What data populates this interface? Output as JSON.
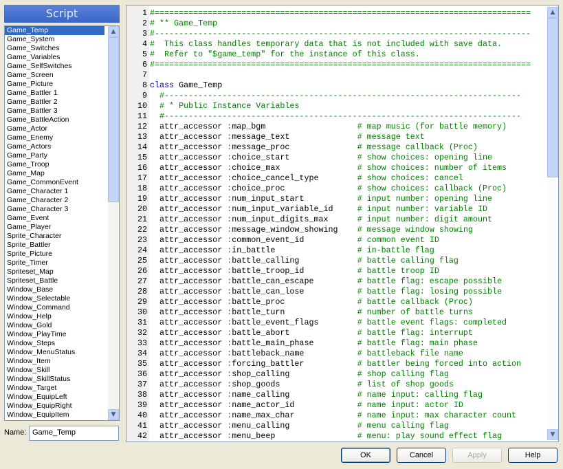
{
  "panel_title": "Script",
  "selected": "Game_Temp",
  "scripts": [
    "Game_Temp",
    "Game_System",
    "Game_Switches",
    "Game_Variables",
    "Game_SelfSwitches",
    "Game_Screen",
    "Game_Picture",
    "Game_Battler 1",
    "Game_Battler 2",
    "Game_Battler 3",
    "Game_BattleAction",
    "Game_Actor",
    "Game_Enemy",
    "Game_Actors",
    "Game_Party",
    "Game_Troop",
    "Game_Map",
    "Game_CommonEvent",
    "Game_Character 1",
    "Game_Character 2",
    "Game_Character 3",
    "Game_Event",
    "Game_Player",
    "Sprite_Character",
    "Sprite_Battler",
    "Sprite_Picture",
    "Sprite_Timer",
    "Spriteset_Map",
    "Spriteset_Battle",
    "Window_Base",
    "Window_Selectable",
    "Window_Command",
    "Window_Help",
    "Window_Gold",
    "Window_PlayTime",
    "Window_Steps",
    "Window_MenuStatus",
    "Window_Item",
    "Window_Skill",
    "Window_SkillStatus",
    "Window_Target",
    "Window_EquipLeft",
    "Window_EquipRight",
    "Window_EquipItem"
  ],
  "name_label": "Name:",
  "name_value": "Game_Temp",
  "colors": {
    "comment": "#008000",
    "keyword": "#0000a0",
    "selection": "#316ac5"
  },
  "code_lines": [
    {
      "t": "c",
      "s": "#=============================================================================="
    },
    {
      "t": "c",
      "s": "# ** Game_Temp"
    },
    {
      "t": "c",
      "s": "#------------------------------------------------------------------------------"
    },
    {
      "t": "c",
      "s": "#  This class handles temporary data that is not included with save data."
    },
    {
      "t": "c",
      "s": "#  Refer to \"$game_temp\" for the instance of this class."
    },
    {
      "t": "c",
      "s": "#=============================================================================="
    },
    {
      "t": "p",
      "s": ""
    },
    {
      "t": "k",
      "kw": "class",
      "s": " Game_Temp"
    },
    {
      "t": "c",
      "s": "  #--------------------------------------------------------------------------"
    },
    {
      "t": "c",
      "s": "  # * Public Instance Variables"
    },
    {
      "t": "c",
      "s": "  #--------------------------------------------------------------------------"
    },
    {
      "t": "a",
      "sym": "map_bgm",
      "cm": "# map music (for battle memory)"
    },
    {
      "t": "a",
      "sym": "message_text",
      "cm": "# message text"
    },
    {
      "t": "a",
      "sym": "message_proc",
      "cm": "# message callback (Proc)"
    },
    {
      "t": "a",
      "sym": "choice_start",
      "cm": "# show choices: opening line"
    },
    {
      "t": "a",
      "sym": "choice_max",
      "cm": "# show choices: number of items"
    },
    {
      "t": "a",
      "sym": "choice_cancel_type",
      "cm": "# show choices: cancel"
    },
    {
      "t": "a",
      "sym": "choice_proc",
      "cm": "# show choices: callback (Proc)"
    },
    {
      "t": "a",
      "sym": "num_input_start",
      "cm": "# input number: opening line"
    },
    {
      "t": "a",
      "sym": "num_input_variable_id",
      "cm": "# input number: variable ID"
    },
    {
      "t": "a",
      "sym": "num_input_digits_max",
      "cm": "# input number: digit amount"
    },
    {
      "t": "a",
      "sym": "message_window_showing",
      "cm": "# message window showing"
    },
    {
      "t": "a",
      "sym": "common_event_id",
      "cm": "# common event ID"
    },
    {
      "t": "a",
      "sym": "in_battle",
      "cm": "# in-battle flag"
    },
    {
      "t": "a",
      "sym": "battle_calling",
      "cm": "# battle calling flag"
    },
    {
      "t": "a",
      "sym": "battle_troop_id",
      "cm": "# battle troop ID"
    },
    {
      "t": "a",
      "sym": "battle_can_escape",
      "cm": "# battle flag: escape possible"
    },
    {
      "t": "a",
      "sym": "battle_can_lose",
      "cm": "# battle flag: losing possible"
    },
    {
      "t": "a",
      "sym": "battle_proc",
      "cm": "# battle callback (Proc)"
    },
    {
      "t": "a",
      "sym": "battle_turn",
      "cm": "# number of battle turns"
    },
    {
      "t": "a",
      "sym": "battle_event_flags",
      "cm": "# battle event flags: completed"
    },
    {
      "t": "a",
      "sym": "battle_abort",
      "cm": "# battle flag: interrupt"
    },
    {
      "t": "a",
      "sym": "battle_main_phase",
      "cm": "# battle flag: main phase"
    },
    {
      "t": "a",
      "sym": "battleback_name",
      "cm": "# battleback file name"
    },
    {
      "t": "a",
      "sym": "forcing_battler",
      "cm": "# battler being forced into action"
    },
    {
      "t": "a",
      "sym": "shop_calling",
      "cm": "# shop calling flag"
    },
    {
      "t": "a",
      "sym": "shop_goods",
      "cm": "# list of shop goods"
    },
    {
      "t": "a",
      "sym": "name_calling",
      "cm": "# name input: calling flag"
    },
    {
      "t": "a",
      "sym": "name_actor_id",
      "cm": "# name input: actor ID"
    },
    {
      "t": "a",
      "sym": "name_max_char",
      "cm": "# name input: max character count"
    },
    {
      "t": "a",
      "sym": "menu_calling",
      "cm": "# menu calling flag"
    },
    {
      "t": "a",
      "sym": "menu_beep",
      "cm": "# menu: play sound effect flag"
    }
  ],
  "attr_prefix": "  attr_accessor ",
  "buttons": {
    "ok": "OK",
    "cancel": "Cancel",
    "apply": "Apply",
    "help": "Help"
  }
}
